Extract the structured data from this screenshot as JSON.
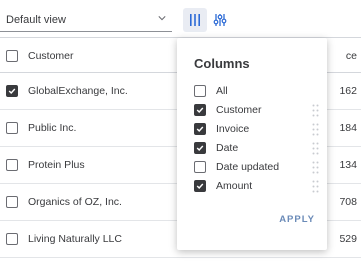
{
  "toolbar": {
    "view_select": {
      "value": "Default view"
    },
    "columns_button": {
      "icon": "columns-icon"
    },
    "settings_button": {
      "icon": "sliders-icon"
    }
  },
  "table": {
    "header": {
      "customer_label": "Customer",
      "amount_label_partial": "ce"
    },
    "rows": [
      {
        "customer": "GlobalExchange, Inc.",
        "amount_partial": "162",
        "checked": true
      },
      {
        "customer": "Public Inc.",
        "amount_partial": "184",
        "checked": false
      },
      {
        "customer": "Protein Plus",
        "amount_partial": "134",
        "checked": false
      },
      {
        "customer": "Organics of OZ, Inc.",
        "amount_partial": "708",
        "checked": false
      },
      {
        "customer": "Living Naturally LLC",
        "amount_partial": "529",
        "checked": false
      }
    ]
  },
  "columns_popover": {
    "title": "Columns",
    "options": [
      {
        "label": "All",
        "checked": false
      },
      {
        "label": "Customer",
        "checked": true
      },
      {
        "label": "Invoice",
        "checked": true
      },
      {
        "label": "Date",
        "checked": true
      },
      {
        "label": "Date updated",
        "checked": false
      },
      {
        "label": "Amount",
        "checked": true
      }
    ],
    "apply_label": "APPLY"
  },
  "colors": {
    "accent": "#6b8bb8",
    "text": "#393a3d",
    "checked": "#393a3d",
    "active_button_bg": "#e9ecf3"
  }
}
